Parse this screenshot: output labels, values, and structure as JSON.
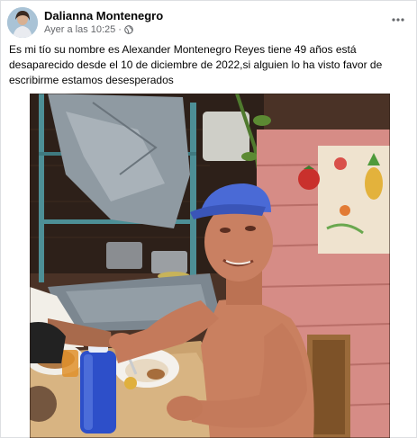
{
  "post": {
    "author": "Dalianna Montenegro",
    "timestamp": "Ayer a las 10:25",
    "separator": "·",
    "audience_icon": "globe-icon",
    "more_icon": "more-options-icon",
    "text": "Es mi tío su nombre es Alexander Montenegro Reyes tiene 49 años está desaparecido desde el 10 de diciembre de 2022,si alguien lo ha visto favor de escribirme estamos desesperados"
  },
  "colors": {
    "author_text": "#050505",
    "meta_text": "#65676b",
    "card_border": "#dddfe2"
  }
}
